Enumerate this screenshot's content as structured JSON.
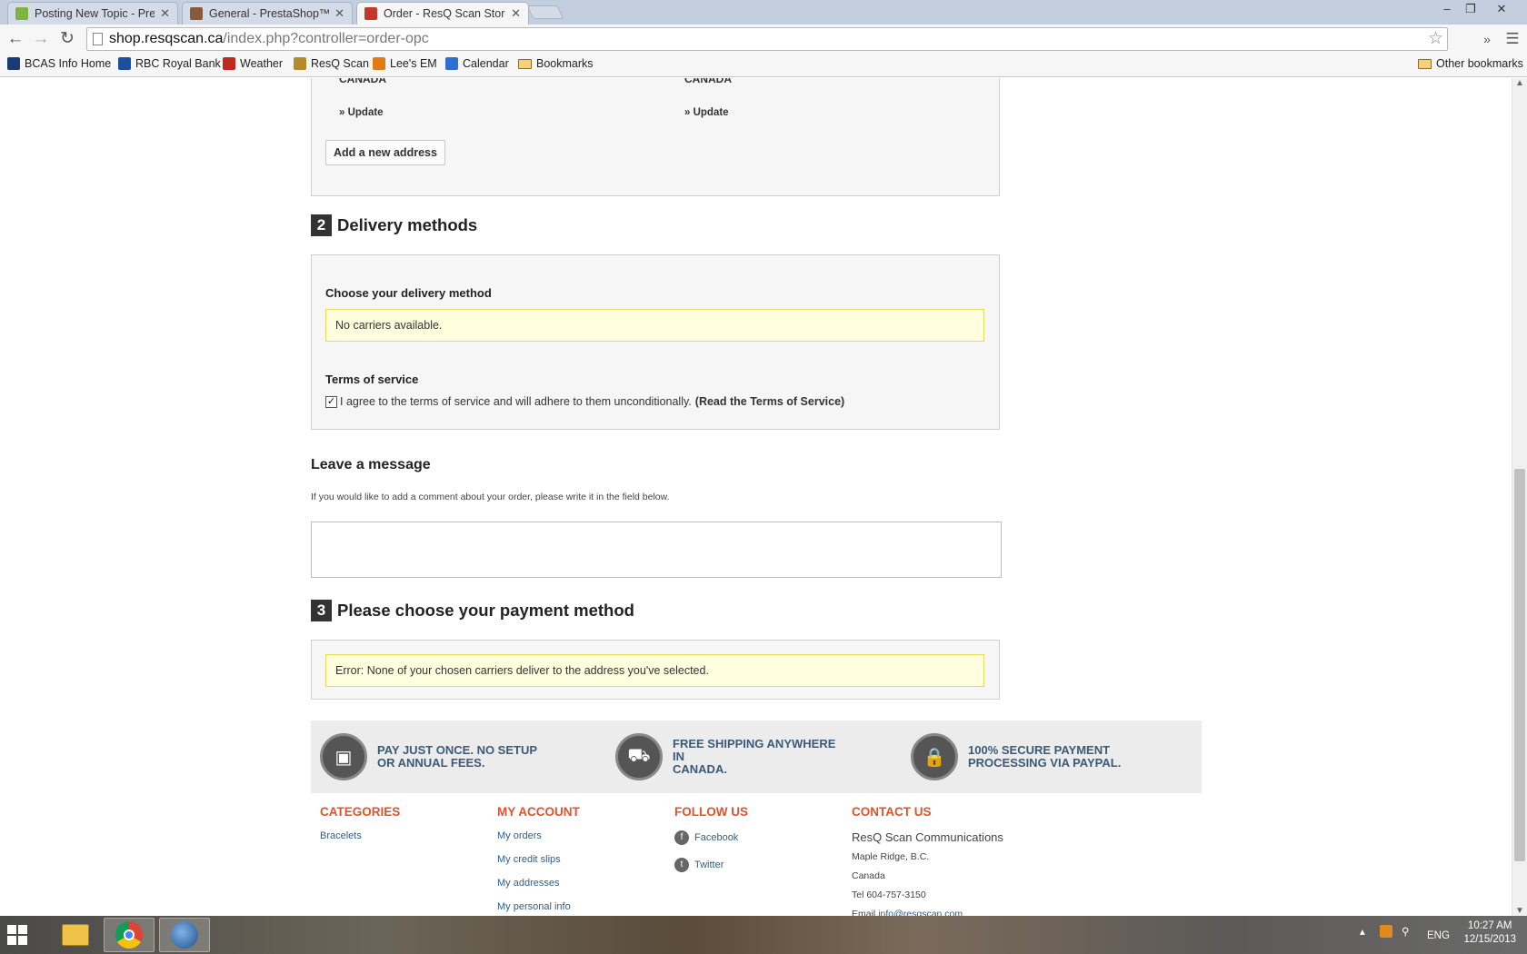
{
  "browser": {
    "tabs": [
      {
        "title": "Posting New Topic - Prest",
        "active": false,
        "favicon_color": "#7cb342"
      },
      {
        "title": "General - PrestaShop™",
        "active": false,
        "favicon_color": "#8a5a3c"
      },
      {
        "title": "Order - ResQ Scan Store",
        "active": true,
        "favicon_color": "#c0392b"
      }
    ],
    "tab_close": "✕",
    "window_controls": {
      "minimize": "–",
      "restore": "❐",
      "close": "✕"
    },
    "nav": {
      "back": "←",
      "forward": "→",
      "reload": "↻",
      "star": "☆",
      "extensions": "»",
      "menu": "☰"
    },
    "address": {
      "domain": "shop.resqscan.ca",
      "path": "/index.php?controller=order-opc"
    },
    "bookmarks": [
      {
        "label": "BCAS Info Home",
        "color": "#1a3a7a"
      },
      {
        "label": "RBC Royal Bank",
        "color": "#1c4fa0"
      },
      {
        "label": "Weather",
        "color": "#c0281e"
      },
      {
        "label": "ResQ Scan",
        "color": "#b58a2a"
      },
      {
        "label": "Lee's EM",
        "color": "#e07b16"
      },
      {
        "label": "Calendar",
        "color": "#2f6fd0"
      },
      {
        "label": "Bookmarks",
        "color": "folder"
      }
    ],
    "other_bookmarks": "Other bookmarks"
  },
  "addresses": {
    "delivery_country": "CANADA",
    "invoice_country": "CANADA",
    "update_label": "» Update",
    "add_button": "Add a new address"
  },
  "delivery": {
    "step_number": "2",
    "title": "Delivery methods",
    "choose_label": "Choose your delivery method",
    "no_carriers": "No carriers available.",
    "tos_title": "Terms of service",
    "tos_checked": true,
    "tos_text": "I agree to the terms of service and will adhere to them unconditionally.",
    "tos_link": "(Read the Terms of Service)"
  },
  "message": {
    "title": "Leave a message",
    "description": "If you would like to add a comment about your order, please write it in the field below.",
    "value": ""
  },
  "payment": {
    "step_number": "3",
    "title": "Please choose your payment method",
    "error": "Error: None of your chosen carriers deliver to the address you've selected."
  },
  "features": [
    {
      "icon": "credit-card-icon",
      "line1": "PAY JUST ONCE. NO SETUP",
      "line2": "OR ANNUAL FEES."
    },
    {
      "icon": "truck-icon",
      "line1": "FREE SHIPPING ANYWHERE IN",
      "line2": "CANADA."
    },
    {
      "icon": "lock-icon",
      "line1": "100% SECURE PAYMENT",
      "line2": "PROCESSING VIA PAYPAL."
    }
  ],
  "footer": {
    "categories": {
      "title": "CATEGORIES",
      "items": [
        "Bracelets"
      ]
    },
    "account": {
      "title": "MY ACCOUNT",
      "items": [
        "My orders",
        "My credit slips",
        "My addresses",
        "My personal info"
      ]
    },
    "follow": {
      "title": "FOLLOW US",
      "items": [
        "Facebook",
        "Twitter"
      ]
    },
    "contact": {
      "title": "CONTACT US",
      "org": "ResQ Scan Communications",
      "city": "Maple Ridge, B.C.",
      "country": "Canada",
      "tel": "Tel 604-757-3150",
      "email_label": "Email",
      "email": "info@resqscan.com"
    }
  },
  "taskbar": {
    "language": "ENG",
    "time": "10:27 AM",
    "date": "12/15/2013"
  },
  "colors": {
    "accent_heading": "#e2522c",
    "link": "#2d5f8a",
    "warning_bg": "#ffffe0",
    "feature_text": "#3a5a78"
  }
}
